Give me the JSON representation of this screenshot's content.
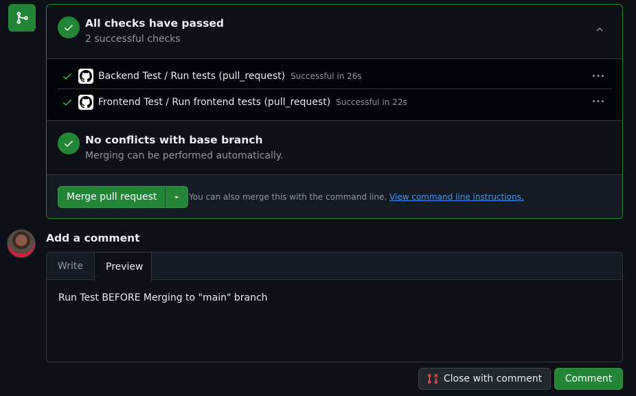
{
  "checks_section": {
    "title": "All checks have passed",
    "subtitle": "2 successful checks",
    "checks": [
      {
        "name": "Backend Test / Run tests (pull_request)",
        "status": "Successful in 26s"
      },
      {
        "name": "Frontend Test / Run frontend tests (pull_request)",
        "status": "Successful in 22s"
      }
    ]
  },
  "conflicts_section": {
    "title": "No conflicts with base branch",
    "subtitle": "Merging can be performed automatically."
  },
  "merge": {
    "button_label": "Merge pull request",
    "hint_text": "You can also merge this with the command line.",
    "hint_link": "View command line instructions."
  },
  "comment": {
    "title": "Add a comment",
    "tabs": [
      "Write",
      "Preview"
    ],
    "active_tab": "Preview",
    "preview_text": "Run Test BEFORE Merging to \"main\" branch",
    "close_button": "Close with comment",
    "submit_button": "Comment"
  },
  "colors": {
    "success": "#238636",
    "link": "#4493f8",
    "background": "#0d1117",
    "danger_icon": "#f85149"
  },
  "icons": {
    "merge": "git-merge-icon",
    "status": "check-circle-icon",
    "check": "check-icon",
    "collapse": "chevron-up-icon",
    "app": "github-icon",
    "more": "kebab-horizontal-icon",
    "dropdown": "triangle-down-icon",
    "close_pr": "git-pull-request-closed-icon"
  }
}
